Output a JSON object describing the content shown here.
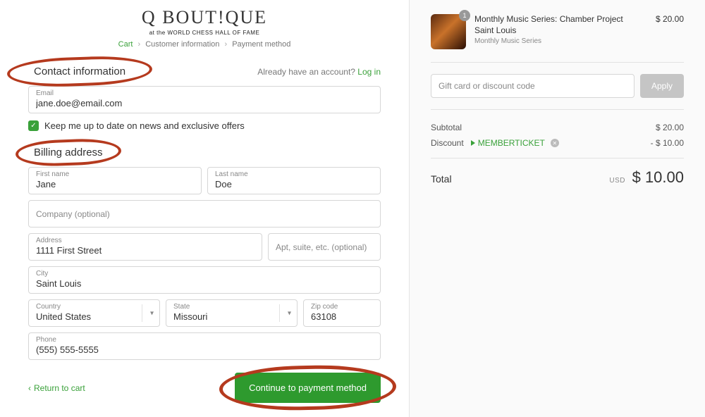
{
  "logo": {
    "main": "Q BOUT!QUE",
    "sub_prefix": "at the ",
    "sub_main": "WORLD CHESS HALL OF FAME"
  },
  "breadcrumb": {
    "cart": "Cart",
    "info": "Customer information",
    "pay": "Payment method"
  },
  "contact": {
    "heading": "Contact information",
    "already": "Already have an account?",
    "login": "Log in",
    "email_label": "Email",
    "email_value": "jane.doe@email.com",
    "optin": "Keep me up to date on news and exclusive offers"
  },
  "billing": {
    "heading": "Billing address",
    "first_label": "First name",
    "first_value": "Jane",
    "last_label": "Last name",
    "last_value": "Doe",
    "company_ph": "Company (optional)",
    "addr_label": "Address",
    "addr_value": "1111 First Street",
    "apt_ph": "Apt, suite, etc. (optional)",
    "city_label": "City",
    "city_value": "Saint Louis",
    "country_label": "Country",
    "country_value": "United States",
    "state_label": "State",
    "state_value": "Missouri",
    "zip_label": "Zip code",
    "zip_value": "63108",
    "phone_label": "Phone",
    "phone_value": "(555) 555-5555"
  },
  "footer": {
    "back": "Return to cart",
    "cta": "Continue to payment method"
  },
  "cart": {
    "item": {
      "qty": "1",
      "title": "Monthly Music Series: Chamber Project Saint Louis",
      "sub": "Monthly Music Series",
      "price": "$ 20.00"
    },
    "promo_ph": "Gift card or discount code",
    "apply": "Apply",
    "subtotal_lbl": "Subtotal",
    "subtotal_val": "$ 20.00",
    "discount_lbl": "Discount",
    "discount_code": "MEMBERTICKET",
    "discount_val": "- $ 10.00",
    "total_lbl": "Total",
    "total_cur": "USD",
    "total_val": "$ 10.00"
  }
}
